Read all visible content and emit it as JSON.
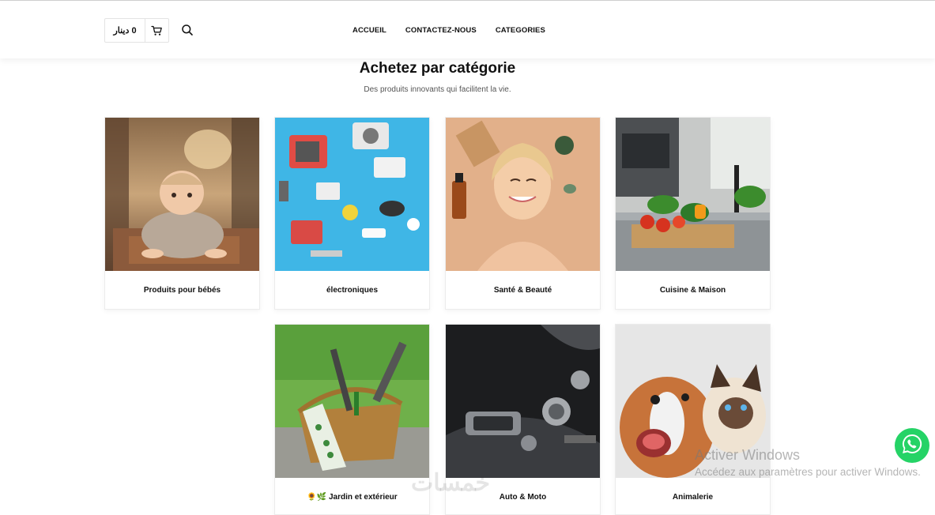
{
  "header": {
    "cart_amount": "0 دينار",
    "nav": [
      "ACCUEIL",
      "CONTACTEZ-NOUS",
      "CATEGORIES"
    ]
  },
  "main": {
    "title": "Achetez par catégorie",
    "subtitle": "Des produits innovants qui facilitent la vie."
  },
  "categories": [
    {
      "label": "Produits pour bébés"
    },
    {
      "label": "électroniques"
    },
    {
      "label": "Santé & Beauté"
    },
    {
      "label": "Cuisine & Maison"
    },
    {
      "label": "🌻🌿 Jardin et extérieur"
    },
    {
      "label": "Auto & Moto"
    },
    {
      "label": "Animalerie"
    }
  ],
  "overlays": {
    "watermark": "خمسات",
    "windows_title": "Activer Windows",
    "windows_sub": "Accédez aux paramètres pour activer Windows."
  },
  "colors": {
    "accent": "#111111",
    "whatsapp": "#25d366"
  }
}
